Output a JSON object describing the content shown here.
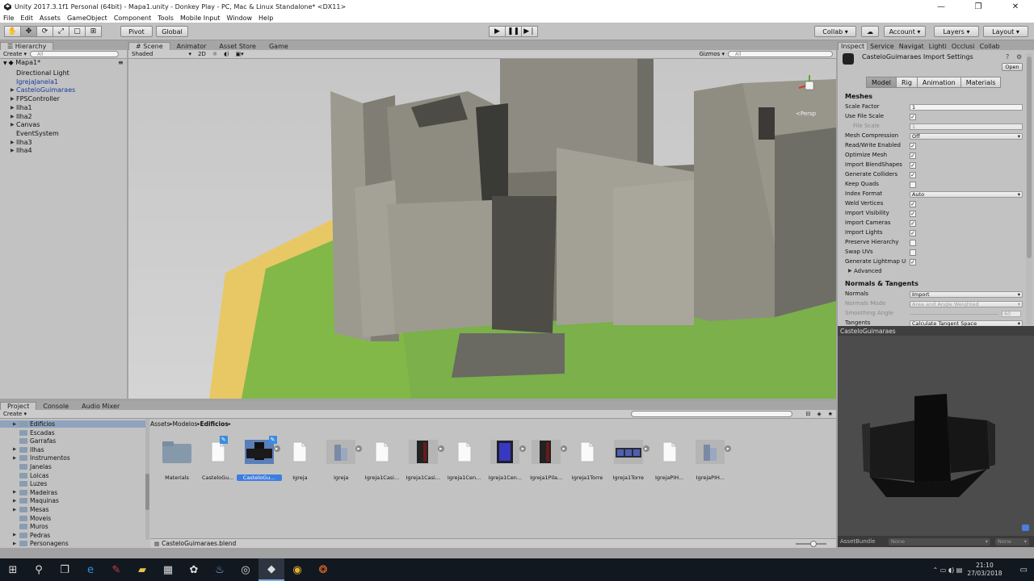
{
  "window": {
    "title": "Unity 2017.3.1f1 Personal (64bit) - Mapa1.unity - Donkey Play - PC, Mac & Linux Standalone* <DX11>"
  },
  "menu": [
    "File",
    "Edit",
    "Assets",
    "GameObject",
    "Component",
    "Tools",
    "Mobile Input",
    "Window",
    "Help"
  ],
  "toolbar": {
    "pivot": "Pivot",
    "global": "Global",
    "collab": "Collab",
    "account": "Account",
    "layers": "Layers",
    "layout": "Layout"
  },
  "hierarchy": {
    "tab": "Hierarchy",
    "create": "Create",
    "search": "All",
    "scene": "Mapa1*",
    "items": [
      {
        "label": "Directional Light",
        "blue": false,
        "arrow": false
      },
      {
        "label": "IgrejaJanela1",
        "blue": true,
        "arrow": false
      },
      {
        "label": "CasteloGuimaraes",
        "blue": true,
        "arrow": true
      },
      {
        "label": "FPSController",
        "blue": false,
        "arrow": true
      },
      {
        "label": "Ilha1",
        "blue": false,
        "arrow": true
      },
      {
        "label": "Ilha2",
        "blue": false,
        "arrow": true
      },
      {
        "label": "Canvas",
        "blue": false,
        "arrow": true
      },
      {
        "label": "EventSystem",
        "blue": false,
        "arrow": false
      },
      {
        "label": "Ilha3",
        "blue": false,
        "arrow": true
      },
      {
        "label": "Ilha4",
        "blue": false,
        "arrow": true
      }
    ]
  },
  "scene": {
    "tabs": [
      "Scene",
      "Animator",
      "Asset Store",
      "Game"
    ],
    "shaded": "Shaded",
    "mode2d": "2D",
    "gizmos": "Gizmos",
    "search": "All",
    "persp": "<Persp"
  },
  "inspector": {
    "tabs": [
      "Inspect",
      "Service",
      "Navigat",
      "Lighti",
      "Occlusi",
      "Collab"
    ],
    "title": "CasteloGuimaraes Import Settings",
    "open": "Open",
    "subtabs": [
      "Model",
      "Rig",
      "Animation",
      "Materials"
    ],
    "meshes_header": "Meshes",
    "rows": [
      {
        "label": "Scale Factor",
        "kind": "field",
        "value": "1",
        "dim": false
      },
      {
        "label": "Use File Scale",
        "kind": "check",
        "value": "✓",
        "dim": false
      },
      {
        "label": "File Scale",
        "kind": "field",
        "value": "1",
        "dim": true
      },
      {
        "label": "Mesh Compression",
        "kind": "drop",
        "value": "Off",
        "dim": false
      },
      {
        "label": "Read/Write Enabled",
        "kind": "check",
        "value": "✓",
        "dim": false
      },
      {
        "label": "Optimize Mesh",
        "kind": "check",
        "value": "✓",
        "dim": false
      },
      {
        "label": "Import BlendShapes",
        "kind": "check",
        "value": "✓",
        "dim": false
      },
      {
        "label": "Generate Colliders",
        "kind": "check",
        "value": "✓",
        "dim": false
      },
      {
        "label": "Keep Quads",
        "kind": "check",
        "value": "",
        "dim": false
      },
      {
        "label": "Index Format",
        "kind": "drop",
        "value": "Auto",
        "dim": false
      },
      {
        "label": "Weld Vertices",
        "kind": "check",
        "value": "✓",
        "dim": false
      },
      {
        "label": "Import Visibility",
        "kind": "check",
        "value": "✓",
        "dim": false
      },
      {
        "label": "Import Cameras",
        "kind": "check",
        "value": "✓",
        "dim": false
      },
      {
        "label": "Import Lights",
        "kind": "check",
        "value": "✓",
        "dim": false
      },
      {
        "label": "Preserve Hierarchy",
        "kind": "check",
        "value": "",
        "dim": false
      },
      {
        "label": "Swap UVs",
        "kind": "check",
        "value": "",
        "dim": false
      },
      {
        "label": "Generate Lightmap U",
        "kind": "check",
        "value": "✓",
        "dim": false
      }
    ],
    "advanced": "Advanced",
    "normals_header": "Normals & Tangents",
    "rows2": [
      {
        "label": "Normals",
        "kind": "drop",
        "value": "Import",
        "dim": false
      },
      {
        "label": "Normals Mode",
        "kind": "drop",
        "value": "Area and Angle Weighted",
        "dim": true
      },
      {
        "label": "Smoothing Angle",
        "kind": "slider",
        "value": "60",
        "dim": true
      },
      {
        "label": "Tangents",
        "kind": "drop",
        "value": "Calculate Tangent Space",
        "dim": false
      }
    ],
    "preview_title": "CasteloGuimaraes",
    "assetbundle": "AssetBundle",
    "none1": "None",
    "none2": "None"
  },
  "project": {
    "tabs": [
      "Project",
      "Console",
      "Audio Mixer"
    ],
    "create": "Create",
    "breadcrumb": [
      "Assets",
      "Modelos",
      "Edificios"
    ],
    "folders": [
      {
        "label": "Edificios",
        "selected": true,
        "arrow": true
      },
      {
        "label": "Escadas",
        "selected": false,
        "arrow": false
      },
      {
        "label": "Garrafas",
        "selected": false,
        "arrow": false
      },
      {
        "label": "Ilhas",
        "selected": false,
        "arrow": true
      },
      {
        "label": "Instrumentos",
        "selected": false,
        "arrow": true
      },
      {
        "label": "Janelas",
        "selected": false,
        "arrow": false
      },
      {
        "label": "Loicas",
        "selected": false,
        "arrow": false
      },
      {
        "label": "Luzes",
        "selected": false,
        "arrow": false
      },
      {
        "label": "Madeiras",
        "selected": false,
        "arrow": true
      },
      {
        "label": "Maquinas",
        "selected": false,
        "arrow": true
      },
      {
        "label": "Mesas",
        "selected": false,
        "arrow": true
      },
      {
        "label": "Moveis",
        "selected": false,
        "arrow": false
      },
      {
        "label": "Muros",
        "selected": false,
        "arrow": false
      },
      {
        "label": "Pedras",
        "selected": false,
        "arrow": true
      },
      {
        "label": "Personagens",
        "selected": false,
        "arrow": true
      }
    ],
    "assets": [
      {
        "label": "Materials",
        "kind": "folder",
        "selected": false
      },
      {
        "label": "CasteloGu...",
        "kind": "doc",
        "selected": false
      },
      {
        "label": "CasteloGu...",
        "kind": "model-dark",
        "selected": true
      },
      {
        "label": "Igreja",
        "kind": "doc",
        "selected": false
      },
      {
        "label": "Igreja",
        "kind": "model-grey",
        "selected": false
      },
      {
        "label": "Igreja1Casi...",
        "kind": "doc",
        "selected": false
      },
      {
        "label": "Igreja1Casi...",
        "kind": "model-door",
        "selected": false
      },
      {
        "label": "Igreja1Cen...",
        "kind": "doc",
        "selected": false
      },
      {
        "label": "Igreja1Cen...",
        "kind": "model-blue",
        "selected": false
      },
      {
        "label": "Igreja1Pila...",
        "kind": "model-door",
        "selected": false
      },
      {
        "label": "Igreja1Torre",
        "kind": "doc",
        "selected": false
      },
      {
        "label": "Igreja1Torre",
        "kind": "model-cubes",
        "selected": false
      },
      {
        "label": "IgrejaPIH...",
        "kind": "doc",
        "selected": false
      },
      {
        "label": "IgrejaPIH...",
        "kind": "model-grey",
        "selected": false
      }
    ],
    "footer": "CasteloGuimaraes.blend"
  },
  "taskbar": {
    "time": "21:10",
    "date": "27/03/2018"
  }
}
